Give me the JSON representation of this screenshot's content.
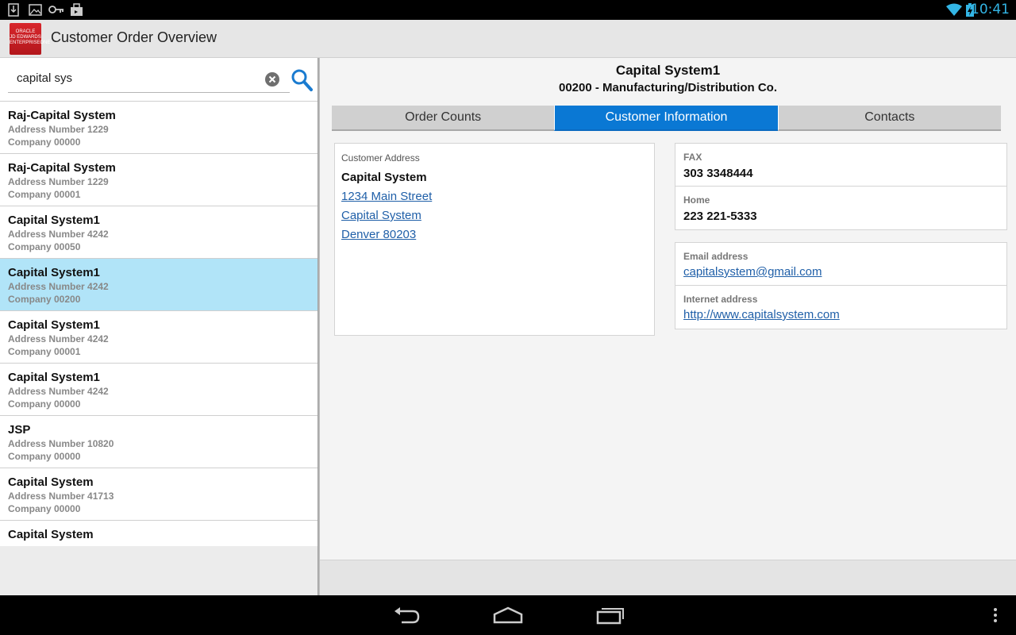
{
  "status_bar": {
    "time": "10:41",
    "icons": [
      "download-icon",
      "image-icon",
      "key-icon",
      "briefcase-icon",
      "wifi-icon",
      "battery-charging-icon"
    ]
  },
  "app": {
    "title": "Customer Order Overview",
    "logo_text": "ORACLE JD EDWARDS ENTERPRISEONE"
  },
  "search": {
    "value": "capital sys",
    "icons": [
      "clear-icon",
      "search-icon"
    ]
  },
  "customers": [
    {
      "name": "Raj-Capital System",
      "address": "Address Number 1229",
      "company": "Company 00000",
      "selected": false
    },
    {
      "name": "Raj-Capital System",
      "address": "Address Number 1229",
      "company": "Company 00001",
      "selected": false
    },
    {
      "name": "Capital System1",
      "address": "Address Number 4242",
      "company": "Company 00050",
      "selected": false
    },
    {
      "name": "Capital System1",
      "address": "Address Number 4242",
      "company": "Company 00200",
      "selected": true
    },
    {
      "name": "Capital System1",
      "address": "Address Number 4242",
      "company": "Company 00001",
      "selected": false
    },
    {
      "name": "Capital System1",
      "address": "Address Number 4242",
      "company": "Company 00000",
      "selected": false
    },
    {
      "name": "JSP",
      "address": "Address Number 10820",
      "company": "Company 00000",
      "selected": false
    },
    {
      "name": "Capital System",
      "address": "Address Number 41713",
      "company": "Company 00000",
      "selected": false
    },
    {
      "name": "Capital System",
      "address": "",
      "company": "",
      "selected": false
    }
  ],
  "detail": {
    "customer_name": "Capital System1",
    "company_line": "00200 - Manufacturing/Distribution Co.",
    "tabs": [
      {
        "label": "Order Counts",
        "active": false
      },
      {
        "label": "Customer Information",
        "active": true
      },
      {
        "label": "Contacts",
        "active": false
      }
    ],
    "address": {
      "label": "Customer Address",
      "name": "Capital System",
      "street": "1234 Main Street",
      "line2": "Capital System",
      "city": "Denver 80203"
    },
    "phones": [
      {
        "label": "FAX",
        "value": "303 3348444"
      },
      {
        "label": "Home",
        "value": "223 221-5333"
      }
    ],
    "web": [
      {
        "label": "Email address",
        "value": "capitalsystem@gmail.com"
      },
      {
        "label": "Internet address",
        "value": "http://www.capitalsystem.com"
      }
    ]
  },
  "nav_bar": {
    "icons": [
      "back-icon",
      "home-icon",
      "recent-apps-icon",
      "overflow-menu-icon"
    ]
  },
  "colors": {
    "accent": "#0a78d4",
    "selected_row": "#b1e4f8",
    "link": "#1f5fa8",
    "status_time": "#33b5e5",
    "logo": "#d8262b"
  }
}
